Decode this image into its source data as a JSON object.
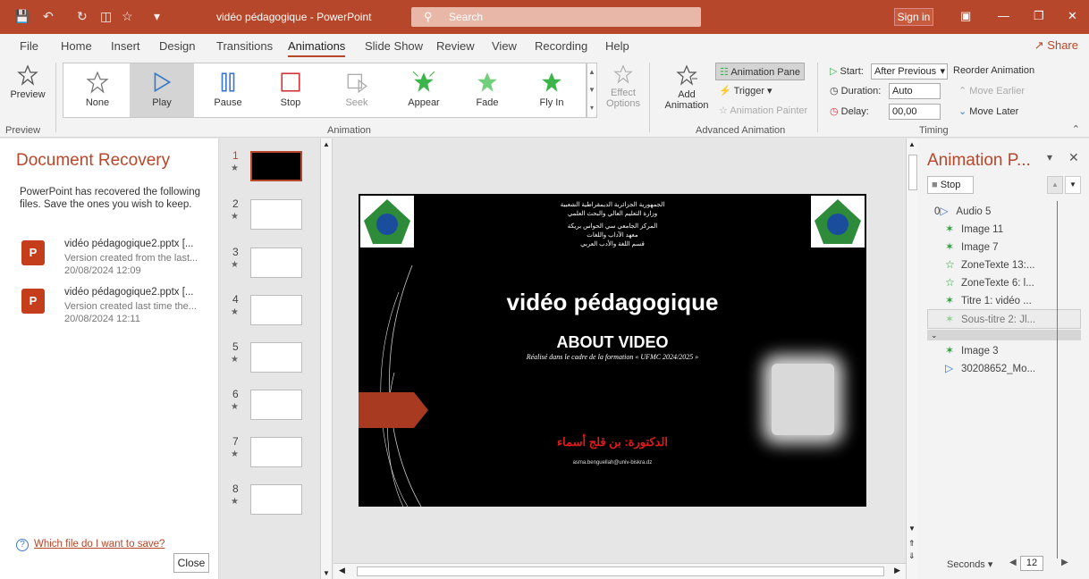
{
  "window": {
    "title": "vidéo pédagogique  -  PowerPoint",
    "search_placeholder": "Search",
    "sign_in": "Sign in"
  },
  "menu": {
    "tabs": [
      "File",
      "Home",
      "Insert",
      "Design",
      "Transitions",
      "Animations",
      "Slide Show",
      "Review",
      "View",
      "Recording",
      "Help"
    ],
    "share": "Share"
  },
  "ribbon": {
    "preview": "Preview",
    "preview_group": "Preview",
    "animations": [
      "None",
      "Play",
      "Pause",
      "Stop",
      "Seek",
      "Appear",
      "Fade",
      "Fly In"
    ],
    "effect_options": "Effect Options",
    "animation_group": "Animation",
    "add_animation": "Add Animation",
    "animation_pane": "Animation Pane",
    "trigger": "Trigger",
    "animation_painter": "Animation Painter",
    "advanced_group": "Advanced Animation",
    "start_label": "Start:",
    "start_value": "After Previous",
    "duration_label": "Duration:",
    "duration_value": "Auto",
    "delay_label": "Delay:",
    "delay_value": "00,00",
    "timing_group": "Timing",
    "reorder": "Reorder Animation",
    "move_earlier": "Move Earlier",
    "move_later": "Move Later"
  },
  "recovery": {
    "title": "Document Recovery",
    "text": "PowerPoint has recovered the following files.  Save the ones you wish to keep.",
    "files": [
      {
        "name": "vidéo pédagogique2.pptx  [...",
        "desc": "Version created from the last...",
        "time": "20/08/2024 12:09"
      },
      {
        "name": "vidéo pédagogique2.pptx  [...",
        "desc": "Version created last time the...",
        "time": "20/08/2024 12:11"
      }
    ],
    "help_link": "Which file do I want to save?",
    "close": "Close"
  },
  "thumbnails": [
    "1",
    "2",
    "3",
    "4",
    "5",
    "6",
    "7",
    "8"
  ],
  "slide": {
    "arabic_header": [
      "الجمهورية الجزائرية الديمقراطية الشعبية",
      "وزارة التعليم العالي والبحث العلمي",
      "المركز الجامعي سي الحواس بريكة",
      "معهد الآداب واللغات",
      "قسم اللغة والأدب العربي"
    ],
    "title": "vidéo pédagogique",
    "subtitle": "ABOUT VIDEO",
    "caption": "Réalisé dans le cadre de la formation « UFMC 2024/2025 »",
    "author": "الدكتورة: بن قلج أسماء",
    "email": "asma.benguellah@univ-biskra.dz"
  },
  "animation_pane": {
    "title": "Animation P...",
    "stop": "Stop",
    "items": [
      {
        "prefix": "0",
        "label": "Audio 5",
        "icon": "play-icon"
      },
      {
        "prefix": "",
        "label": "Image 11",
        "icon": "fly-icon"
      },
      {
        "prefix": "",
        "label": "Image 7",
        "icon": "fly-icon"
      },
      {
        "prefix": "",
        "label": "ZoneTexte 13:...",
        "icon": "star-icon"
      },
      {
        "prefix": "",
        "label": "ZoneTexte 6: l...",
        "icon": "star-icon"
      },
      {
        "prefix": "",
        "label": "Titre 1: vidéo ...",
        "icon": "fly-icon"
      },
      {
        "prefix": "",
        "label": "Sous-titre 2: Jl...",
        "icon": "fly-icon"
      },
      {
        "prefix": "",
        "label": "Image 3",
        "icon": "fly-icon"
      },
      {
        "prefix": "",
        "label": "30208652_Mo...",
        "icon": "play-icon"
      }
    ],
    "seconds_label": "Seconds",
    "seconds_value": "12"
  },
  "colors": {
    "accent": "#b7472a"
  }
}
